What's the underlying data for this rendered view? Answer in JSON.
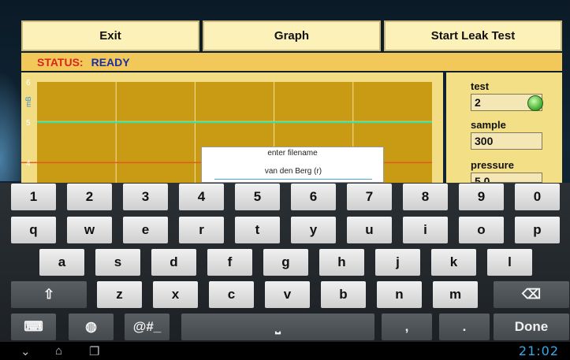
{
  "toolbar": {
    "exit_label": "Exit",
    "graph_label": "Graph",
    "start_label": "Start Leak Test"
  },
  "status": {
    "label": "STATUS:",
    "value": "READY"
  },
  "chart_data": {
    "type": "line",
    "ylabel": "mB",
    "y_ticks": [
      "4",
      "5",
      "6"
    ],
    "ylim": [
      3.5,
      6
    ],
    "reference_line_y": 4,
    "series": [
      {
        "values": [
          5.0,
          5.0,
          5.0,
          5.0,
          5.0,
          5.0,
          5.0
        ]
      }
    ],
    "grid": true
  },
  "panel": {
    "test_label": "test",
    "test_value": "2",
    "sample_label": "sample",
    "sample_value": "300",
    "pressure_label": "pressure",
    "pressure_value": "5.0"
  },
  "dialog": {
    "title": "enter filename",
    "value": "van den Berg (r)"
  },
  "keyboard": {
    "row1": [
      "1",
      "2",
      "3",
      "4",
      "5",
      "6",
      "7",
      "8",
      "9",
      "0"
    ],
    "row2": [
      "q",
      "w",
      "e",
      "r",
      "t",
      "y",
      "u",
      "i",
      "o",
      "p"
    ],
    "row3": [
      "a",
      "s",
      "d",
      "f",
      "g",
      "h",
      "j",
      "k",
      "l"
    ],
    "row4": [
      "z",
      "x",
      "c",
      "v",
      "b",
      "n",
      "m"
    ],
    "symbols_label": "@#_",
    "comma": ",",
    "period": ".",
    "done_label": "Done"
  },
  "icons": {
    "shift": "shift-icon",
    "backspace": "backspace-icon",
    "keyboard": "keyboard-settings-icon",
    "globe": "globe-icon",
    "space": "space-icon"
  },
  "system": {
    "clock": "21:02"
  },
  "colors": {
    "status_label": "#d6261e",
    "status_value": "#1c2fa0",
    "accent": "#3aa7e7"
  }
}
